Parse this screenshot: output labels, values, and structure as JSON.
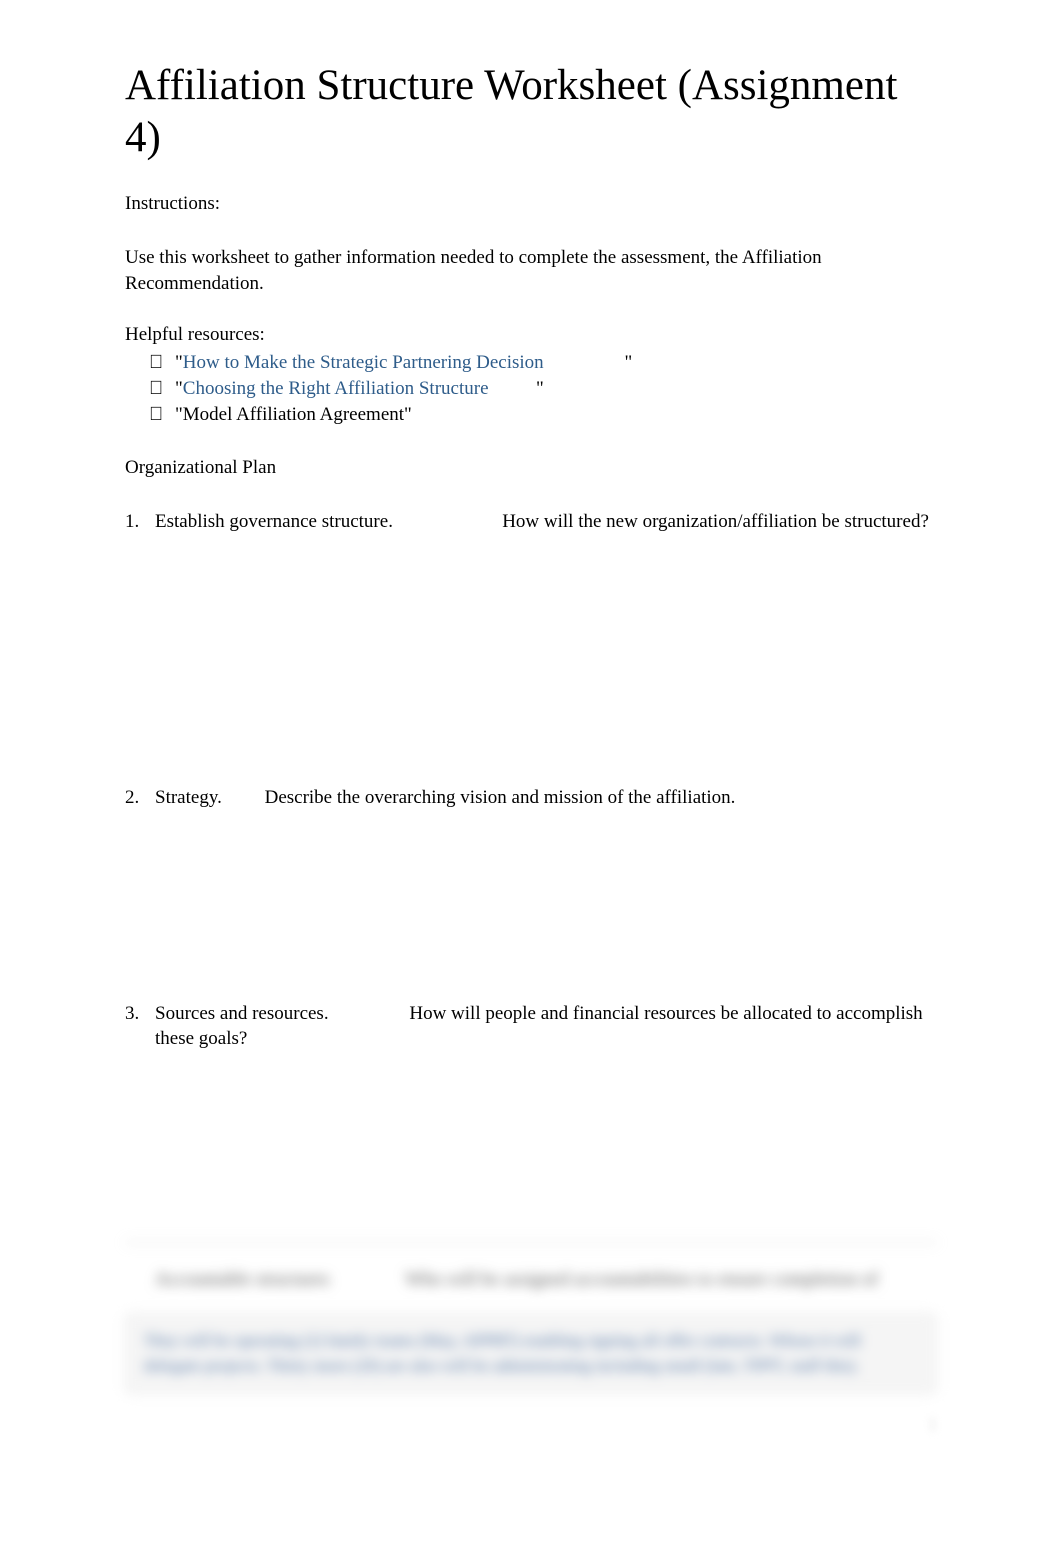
{
  "title": "Affiliation Structure Worksheet (Assignment 4)",
  "instructions_label": "Instructions:",
  "intro": "Use this worksheet to gather information needed to complete the assessment, the Affiliation Recommendation.",
  "resources_label": "Helpful resources:",
  "resources": [
    {
      "text": "How to Make the Strategic Partnering Decision",
      "is_link": true
    },
    {
      "text": "Choosing the Right Affiliation Structure",
      "is_link": true
    },
    {
      "text": "Model Affiliation Agreement",
      "is_link": false
    }
  ],
  "section_heading": "Organizational Plan",
  "questions": [
    {
      "num": "1.",
      "label": "Establish governance structure.",
      "prompt": "How will the new organization/affiliation be structured?"
    },
    {
      "num": "2.",
      "label": "Strategy.",
      "prompt": "Describe the overarching vision and mission of the affiliation."
    },
    {
      "num": "3.",
      "label": "Sources and resources.",
      "prompt": "How will people and financial resources be allocated to accomplish these goals?"
    }
  ],
  "blurred": {
    "row_label": "Accountable structures",
    "row_prompt": "Who will be assigned accountabilities to ensure completion of",
    "box_text": "They will be operating (2) family teams (May, APPRT) enabling signing all offer contracts. Whose it will delegate projects. Thirty more (20) are also will be administrating including small (late, TPPT, staff this)."
  },
  "page_num": "1"
}
